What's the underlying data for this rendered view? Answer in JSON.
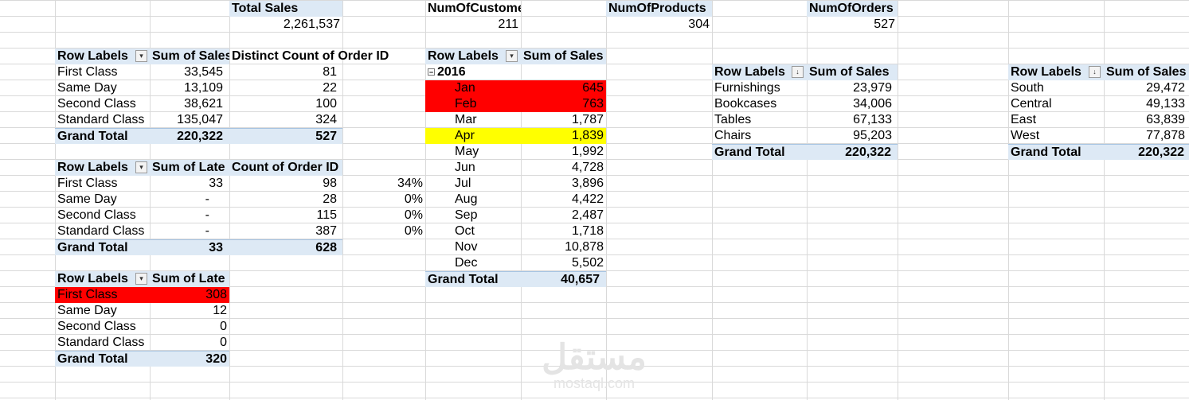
{
  "kpis": {
    "total_sales": {
      "label": "Total Sales",
      "value": "2,261,537"
    },
    "customers": {
      "label": "NumOfCustomers",
      "value": "211"
    },
    "products": {
      "label": "NumOfProducts",
      "value": "304"
    },
    "orders": {
      "label": "NumOfOrders",
      "value": "527"
    }
  },
  "pivot1": {
    "headers": [
      "Row Labels",
      "Sum of Sales",
      "Distinct Count of Order ID"
    ],
    "rows": [
      [
        "First Class",
        "33,545",
        "81"
      ],
      [
        "Same Day",
        "13,109",
        "22"
      ],
      [
        "Second Class",
        "38,621",
        "100"
      ],
      [
        "Standard Class",
        "135,047",
        "324"
      ]
    ],
    "total": [
      "Grand Total",
      "220,322",
      "527"
    ]
  },
  "pivot2": {
    "headers": [
      "Row Labels",
      "Sum of Late",
      "Count of Order ID"
    ],
    "rows": [
      [
        "First Class",
        "33",
        "98",
        "34%"
      ],
      [
        "Same Day",
        "-",
        "28",
        "0%"
      ],
      [
        "Second Class",
        "-",
        "115",
        "0%"
      ],
      [
        "Standard Class",
        "-",
        "387",
        "0%"
      ]
    ],
    "total": [
      "Grand Total",
      "33",
      "628"
    ]
  },
  "pivot3": {
    "headers": [
      "Row Labels",
      "Sum of Late"
    ],
    "rows": [
      [
        "First Class",
        "308"
      ],
      [
        "Same Day",
        "12"
      ],
      [
        "Second Class",
        "0"
      ],
      [
        "Standard Class",
        "0"
      ]
    ],
    "total": [
      "Grand Total",
      "320"
    ]
  },
  "pivot_month": {
    "headers": [
      "Row Labels",
      "Sum of Sales"
    ],
    "year": "2016",
    "expander": "−",
    "rows": [
      [
        "Jan",
        "645"
      ],
      [
        "Feb",
        "763"
      ],
      [
        "Mar",
        "1,787"
      ],
      [
        "Apr",
        "1,839"
      ],
      [
        "May",
        "1,992"
      ],
      [
        "Jun",
        "4,728"
      ],
      [
        "Jul",
        "3,896"
      ],
      [
        "Aug",
        "4,422"
      ],
      [
        "Sep",
        "2,487"
      ],
      [
        "Oct",
        "1,718"
      ],
      [
        "Nov",
        "10,878"
      ],
      [
        "Dec",
        "5,502"
      ]
    ],
    "total": [
      "Grand Total",
      "40,657"
    ]
  },
  "pivot_category": {
    "headers": [
      "Row Labels",
      "Sum of Sales"
    ],
    "rows": [
      [
        "Furnishings",
        "23,979"
      ],
      [
        "Bookcases",
        "34,006"
      ],
      [
        "Tables",
        "67,133"
      ],
      [
        "Chairs",
        "95,203"
      ]
    ],
    "total": [
      "Grand Total",
      "220,322"
    ]
  },
  "pivot_region": {
    "headers": [
      "Row Labels",
      "Sum of Sales"
    ],
    "rows": [
      [
        "South",
        "29,472"
      ],
      [
        "Central",
        "49,133"
      ],
      [
        "East",
        "63,839"
      ],
      [
        "West",
        "77,878"
      ]
    ],
    "total": [
      "Grand Total",
      "220,322"
    ]
  },
  "icons": {
    "dropdown": "▾",
    "filtered": "▾",
    "sorted": "↓"
  },
  "colors": {
    "header_fill": "#dde9f5",
    "highlight_red": "#ff0000",
    "highlight_yellow": "#ffff00",
    "gridline": "#d9d9d9"
  },
  "watermark": {
    "arabic": "مستقل",
    "latin": "mostaql.com"
  }
}
